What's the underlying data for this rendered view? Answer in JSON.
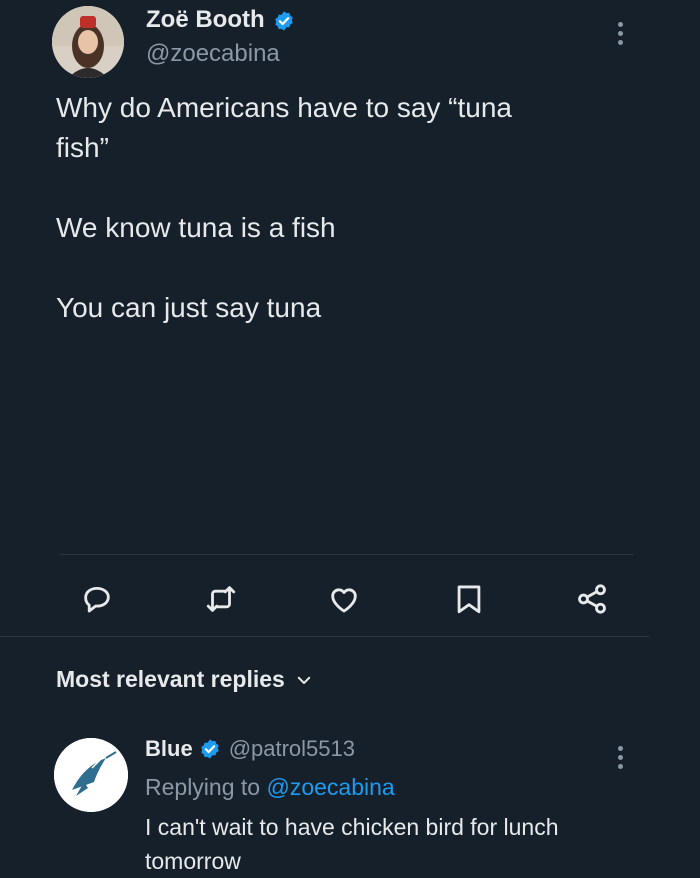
{
  "tweet": {
    "author_name": "Zoë Booth",
    "author_handle": "@zoecabina",
    "text_line1": "Why do Americans have to say “tuna",
    "text_line2": "fish”",
    "text_line3": "We know tuna is a fish",
    "text_line4": "You can just say tuna"
  },
  "actions": [
    "reply-icon",
    "retweet-icon",
    "like-icon",
    "bookmark-icon",
    "share-icon"
  ],
  "replies_header": {
    "label": "Most relevant replies"
  },
  "reply": {
    "author_name": "Blue",
    "author_handle": "@patrol5513",
    "replying_prefix": "Replying to ",
    "replying_handle": "@zoecabina",
    "text_line1": "I can't wait to have chicken bird for lunch",
    "text_line2": "tomorrow"
  },
  "colors": {
    "background": "#15202b",
    "text": "#e7e9ea",
    "muted": "#8b98a5",
    "accent": "#1d9bf0"
  }
}
